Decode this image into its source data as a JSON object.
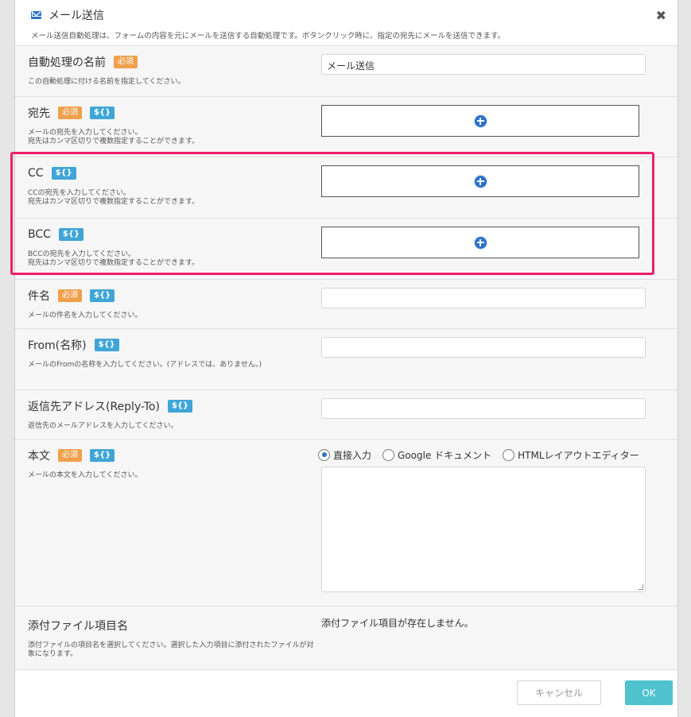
{
  "dialog": {
    "title": "メール送信",
    "subtitle": "メール送信自動処理は、フォームの内容を元にメールを送信する自動処理です。ボタンクリック時に、指定の宛先にメールを送信できます。",
    "close_glyph": "✖"
  },
  "badges": {
    "required": "必須",
    "variable": "${}"
  },
  "rows": {
    "name": {
      "label": "自動処理の名前",
      "desc": "この自動処理に付ける名前を指定してください。",
      "value": "メール送信"
    },
    "to": {
      "label": "宛先",
      "desc1": "メールの宛先を入力してください。",
      "desc2": "宛先はカンマ区切りで複数指定することができます。"
    },
    "cc": {
      "label": "CC",
      "desc1": "CCの宛先を入力してください。",
      "desc2": "宛先はカンマ区切りで複数指定することができます。"
    },
    "bcc": {
      "label": "BCC",
      "desc1": "BCCの宛先を入力してください。",
      "desc2": "宛先はカンマ区切りで複数指定することができます。"
    },
    "subject": {
      "label": "件名",
      "desc": "メールの件名を入力してください。",
      "value": ""
    },
    "from": {
      "label": "From(名称)",
      "desc": "メールのFromの名称を入力してください。(アドレスでは、ありません。)",
      "value": ""
    },
    "reply_to": {
      "label": "返信先アドレス(Reply-To)",
      "desc": "返信先のメールアドレスを入力してください。",
      "value": ""
    },
    "body": {
      "label": "本文",
      "desc": "メールの本文を入力してください。",
      "options": [
        "直接入力",
        "Google ドキュメント",
        "HTMLレイアウトエディター"
      ],
      "selected": "直接入力"
    },
    "attach": {
      "label": "添付ファイル項目名",
      "desc": "添付ファイルの項目名を選択してください。選択した入力項目に添付されたファイルが対象になります。",
      "value": "添付ファイル項目が存在しません。"
    }
  },
  "footer": {
    "cancel_label": "キャンセル",
    "ok_label": "OK"
  },
  "colors": {
    "accent": "#2c72c9",
    "required": "#f0a04b",
    "variable": "#3fa5d6",
    "ok": "#4fc2cd",
    "highlight": "#ee1f6a"
  }
}
